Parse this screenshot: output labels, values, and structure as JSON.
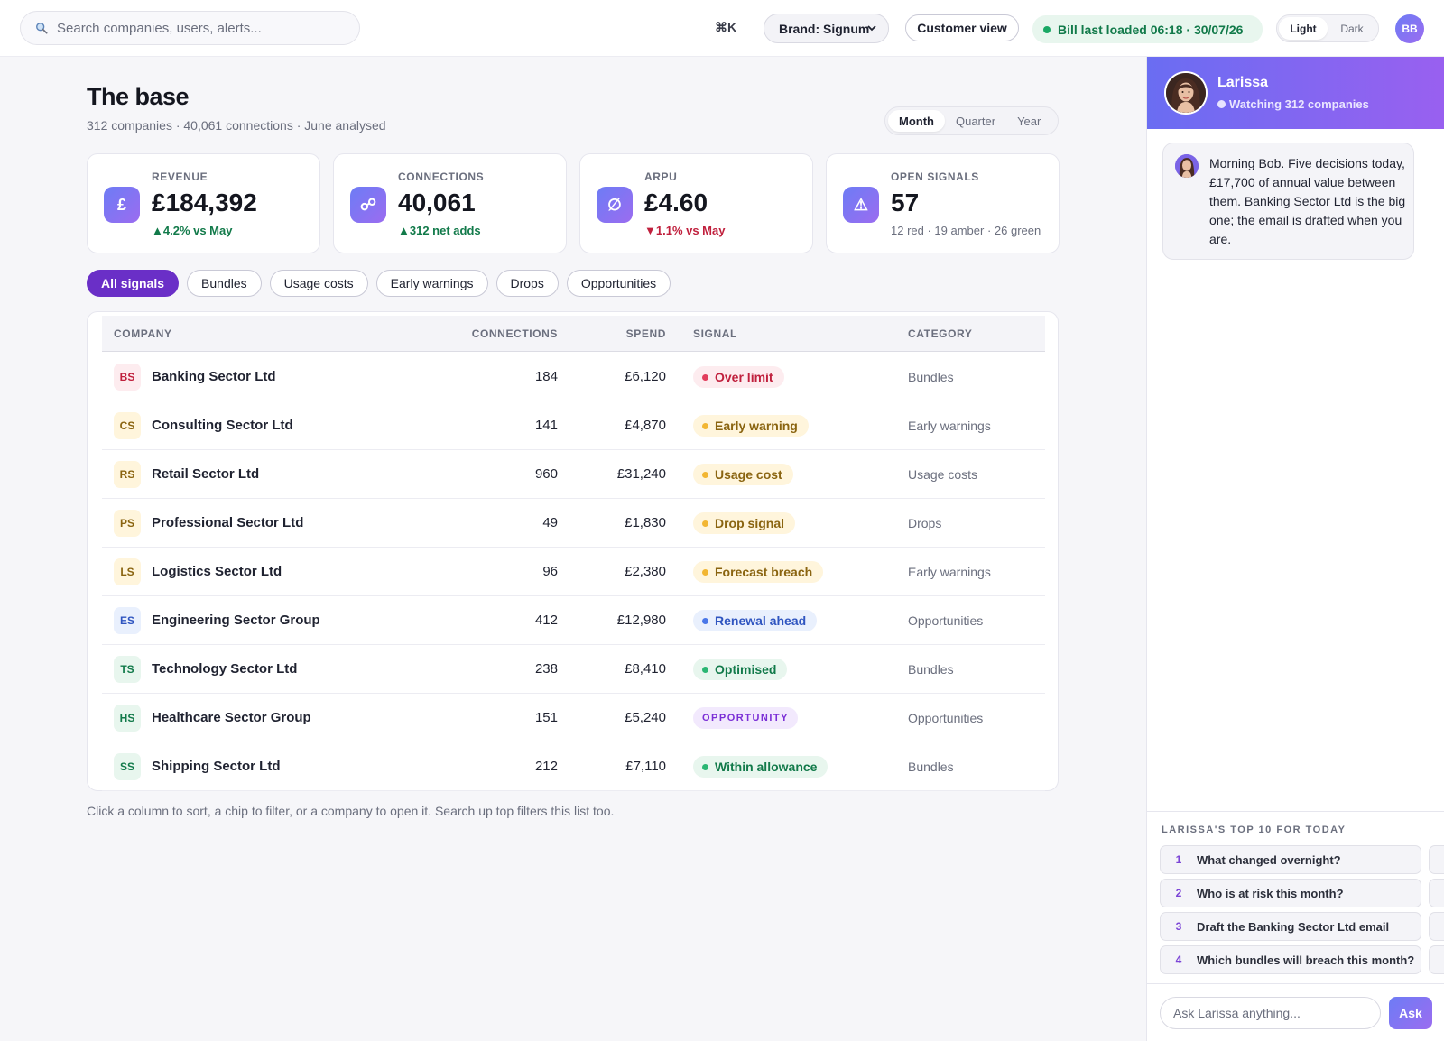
{
  "topbar": {
    "search_placeholder": "Search companies, users, alerts...",
    "shortcut": "⌘K",
    "brand_select": "Brand: Signum",
    "customer_view": "Customer view",
    "status": "Bill last loaded 06:18 · 30/07/26",
    "theme": {
      "light": "Light",
      "dark": "Dark",
      "selected": "Light"
    },
    "user_initials": "BB"
  },
  "main": {
    "title": "The base",
    "subtitle": "312 companies · 40,061 connections · June analysed",
    "period": {
      "options": [
        "Month",
        "Quarter",
        "Year"
      ],
      "selected": "Month"
    },
    "kpis": [
      {
        "icon": "£",
        "label": "REVENUE",
        "value": "£184,392",
        "delta": "▲4.2% vs May",
        "trend": "up"
      },
      {
        "icon": "☍",
        "label": "CONNECTIONS",
        "value": "40,061",
        "delta": "▲312 net adds",
        "trend": "up"
      },
      {
        "icon": "∅",
        "label": "ARPU",
        "value": "£4.60",
        "delta": "▼1.1% vs May",
        "trend": "down"
      },
      {
        "icon": "⚠",
        "label": "OPEN SIGNALS",
        "value": "57",
        "delta": "12 red · 19 amber · 26 green",
        "trend": "neutral"
      }
    ],
    "chips": [
      "All signals",
      "Bundles",
      "Usage costs",
      "Early warnings",
      "Drops",
      "Opportunities"
    ],
    "active_chip": "All signals",
    "table": {
      "headers": {
        "company": "COMPANY",
        "connections": "CONNECTIONS",
        "spend": "SPEND",
        "signal": "SIGNAL",
        "category": "CATEGORY"
      },
      "rows": [
        {
          "initials": "BS",
          "company": "Banking Sector Ltd",
          "connections": "184",
          "spend": "£6,120",
          "signal": "Over limit",
          "level": "red",
          "category": "Bundles"
        },
        {
          "initials": "CS",
          "company": "Consulting Sector Ltd",
          "connections": "141",
          "spend": "£4,870",
          "signal": "Early warning",
          "level": "amber",
          "category": "Early warnings"
        },
        {
          "initials": "RS",
          "company": "Retail Sector Ltd",
          "connections": "960",
          "spend": "£31,240",
          "signal": "Usage cost",
          "level": "amber",
          "category": "Usage costs"
        },
        {
          "initials": "PS",
          "company": "Professional Sector Ltd",
          "connections": "49",
          "spend": "£1,830",
          "signal": "Drop signal",
          "level": "amber",
          "category": "Drops"
        },
        {
          "initials": "LS",
          "company": "Logistics Sector Ltd",
          "connections": "96",
          "spend": "£2,380",
          "signal": "Forecast breach",
          "level": "amber",
          "category": "Early warnings"
        },
        {
          "initials": "ES",
          "company": "Engineering Sector Group",
          "connections": "412",
          "spend": "£12,980",
          "signal": "Renewal ahead",
          "level": "blue",
          "category": "Opportunities"
        },
        {
          "initials": "TS",
          "company": "Technology Sector Ltd",
          "connections": "238",
          "spend": "£8,410",
          "signal": "Optimised",
          "level": "green",
          "category": "Bundles"
        },
        {
          "initials": "HS",
          "company": "Healthcare Sector Group",
          "connections": "151",
          "spend": "£5,240",
          "signal": "OPPORTUNITY",
          "level": "purple",
          "category": "Opportunities"
        },
        {
          "initials": "SS",
          "company": "Shipping Sector Ltd",
          "connections": "212",
          "spend": "£7,110",
          "signal": "Within allowance",
          "level": "green",
          "category": "Bundles"
        }
      ]
    },
    "hint": "Click a column to sort, a chip to filter, or a company to open it. Search up top filters this list too."
  },
  "assistant": {
    "name": "Larissa",
    "status": "Watching 312 companies",
    "message": "Morning Bob. Five decisions today, £17,700 of annual value between them. Banking Sector Ltd is the big one; the email is drafted when you are.",
    "top10_label": "LARISSA'S TOP 10 FOR TODAY",
    "questions": [
      {
        "n": "1",
        "text": "What changed overnight?"
      },
      {
        "n": "2",
        "text": "Who is at risk this month?"
      },
      {
        "n": "3",
        "text": "Draft the Banking Sector Ltd email"
      },
      {
        "n": "4",
        "text": "Which bundles will breach this month?"
      }
    ],
    "ask_placeholder": "Ask Larissa anything...",
    "ask_button": "Ask"
  },
  "colors": {
    "accent": "#6a2fc7",
    "brand_gradient_start": "#6d7cf5",
    "brand_gradient_end": "#9b6cf0",
    "red": "#c0203d",
    "amber": "#8a6410",
    "green": "#127a4a",
    "blue": "#2f55c0"
  }
}
